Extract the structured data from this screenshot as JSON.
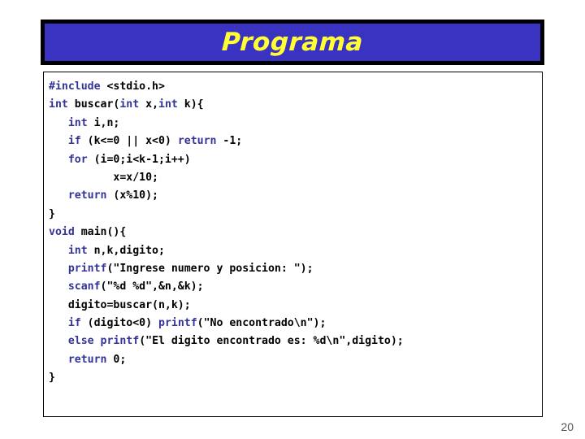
{
  "slide": {
    "title": "Programa",
    "page_number": "20",
    "colors": {
      "title_bar_background": "#3a32c0",
      "title_bar_border": "#000000",
      "title_text": "#ffff33",
      "code_keyword": "#333399",
      "code_plain": "#000000",
      "code_box_border": "#000000",
      "slide_background": "#ffffff",
      "page_number_text": "#555555"
    }
  },
  "code": {
    "language": "c",
    "lines": [
      {
        "indent": 0,
        "tokens": [
          {
            "t": "kw",
            "v": "#include"
          },
          {
            "t": "pl",
            "v": " <stdio.h>"
          }
        ]
      },
      {
        "indent": 0,
        "tokens": [
          {
            "t": "kw",
            "v": "int"
          },
          {
            "t": "pl",
            "v": " buscar("
          },
          {
            "t": "kw",
            "v": "int"
          },
          {
            "t": "pl",
            "v": " x,"
          },
          {
            "t": "kw",
            "v": "int"
          },
          {
            "t": "pl",
            "v": " k){"
          }
        ]
      },
      {
        "indent": 3,
        "tokens": [
          {
            "t": "kw",
            "v": "int"
          },
          {
            "t": "pl",
            "v": " i,n;"
          }
        ]
      },
      {
        "indent": 3,
        "tokens": [
          {
            "t": "kw",
            "v": "if"
          },
          {
            "t": "pl",
            "v": " (k<=0 || x<0) "
          },
          {
            "t": "kw",
            "v": "return"
          },
          {
            "t": "pl",
            "v": " -1;"
          }
        ]
      },
      {
        "indent": 3,
        "tokens": [
          {
            "t": "kw",
            "v": "for"
          },
          {
            "t": "pl",
            "v": " (i=0;i<k-1;i++)"
          }
        ]
      },
      {
        "indent": 10,
        "tokens": [
          {
            "t": "pl",
            "v": "x=x/10;"
          }
        ]
      },
      {
        "indent": 3,
        "tokens": [
          {
            "t": "kw",
            "v": "return"
          },
          {
            "t": "pl",
            "v": " (x%10);"
          }
        ]
      },
      {
        "indent": 0,
        "tokens": [
          {
            "t": "pl",
            "v": "}"
          }
        ]
      },
      {
        "indent": 0,
        "tokens": [
          {
            "t": "kw",
            "v": "void"
          },
          {
            "t": "pl",
            "v": " main(){"
          }
        ]
      },
      {
        "indent": 3,
        "tokens": [
          {
            "t": "kw",
            "v": "int"
          },
          {
            "t": "pl",
            "v": " n,k,digito;"
          }
        ]
      },
      {
        "indent": 3,
        "tokens": [
          {
            "t": "kw",
            "v": "printf"
          },
          {
            "t": "pl",
            "v": "(\"Ingrese numero y posicion: \");"
          }
        ]
      },
      {
        "indent": 3,
        "tokens": [
          {
            "t": "kw",
            "v": "scanf"
          },
          {
            "t": "pl",
            "v": "(\"%d %d\",&n,&k);"
          }
        ]
      },
      {
        "indent": 3,
        "tokens": [
          {
            "t": "pl",
            "v": "digito=buscar(n,k);"
          }
        ]
      },
      {
        "indent": 3,
        "tokens": [
          {
            "t": "kw",
            "v": "if"
          },
          {
            "t": "pl",
            "v": " (digito<0) "
          },
          {
            "t": "kw",
            "v": "printf"
          },
          {
            "t": "pl",
            "v": "(\"No encontrado\\n\");"
          }
        ]
      },
      {
        "indent": 3,
        "tokens": [
          {
            "t": "kw",
            "v": "else"
          },
          {
            "t": "pl",
            "v": " "
          },
          {
            "t": "kw",
            "v": "printf"
          },
          {
            "t": "pl",
            "v": "(\"El digito encontrado es: %d\\n\",digito);"
          }
        ]
      },
      {
        "indent": 3,
        "tokens": [
          {
            "t": "kw",
            "v": "return"
          },
          {
            "t": "pl",
            "v": " 0;"
          }
        ]
      },
      {
        "indent": 0,
        "tokens": [
          {
            "t": "pl",
            "v": "}"
          }
        ]
      }
    ]
  }
}
